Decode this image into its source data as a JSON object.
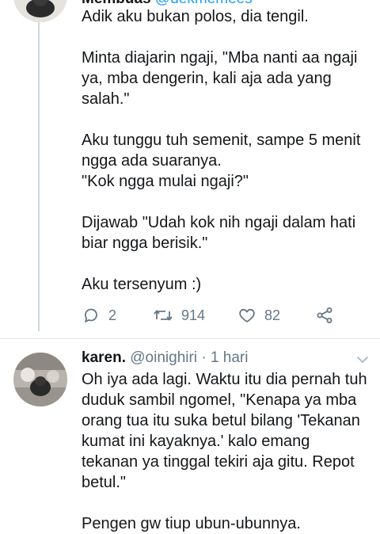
{
  "tweet1": {
    "header_partial": {
      "name": "Membuas",
      "handle": "@dekmemees"
    },
    "paragraphs": [
      "Adik aku bukan polos, dia tengil.",
      "Minta diajarin ngaji, \"Mba nanti aa ngaji ya, mba dengerin, kali aja ada yang salah.\"",
      "Aku tunggu tuh semenit, sampe 5 menit ngga ada suaranya.\n\"Kok ngga mulai ngaji?\"",
      "Dijawab \"Udah kok nih ngaji dalam hati biar ngga berisik.\"",
      "Aku tersenyum :)"
    ],
    "actions": {
      "reply_icon": "reply-icon",
      "reply_count": "2",
      "retweet_icon": "retweet-icon",
      "retweet_count": "914",
      "like_icon": "heart-icon",
      "like_count": "82",
      "share_icon": "share-icon"
    }
  },
  "tweet2": {
    "name": "karen.",
    "handle": "@oinighiri",
    "separator": "·",
    "time": "1 hari",
    "menu_icon": "chevron-down-icon",
    "paragraphs": [
      "Oh iya ada lagi. Waktu itu dia pernah tuh duduk sambil ngomel, \"Kenapa ya mba orang tua itu suka betul bilang 'Tekanan kumat ini kayaknya.' kalo emang tekanan ya tinggal tekiri aja gitu. Repot betul.\"",
      "Pengen gw tiup ubun-ubunnya."
    ]
  },
  "colors": {
    "text": "#14171a",
    "secondary": "#657786",
    "link": "#1da1f2",
    "divider": "#e1e8ed",
    "thread_line": "#ccd6dd"
  }
}
